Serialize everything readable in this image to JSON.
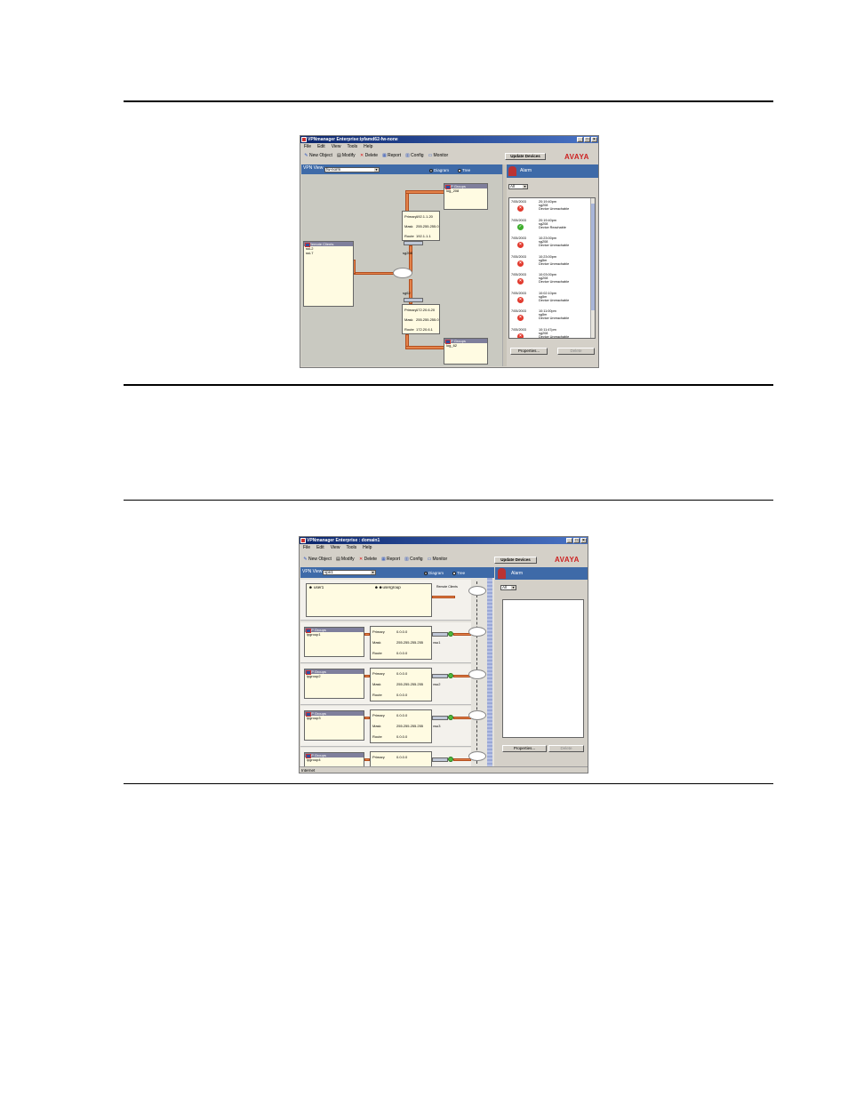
{
  "menu": [
    "File",
    "Edit",
    "View",
    "Tools",
    "Help"
  ],
  "toolbar": {
    "new_object": "New Object",
    "modify": "Modify",
    "delete": "Delete",
    "report": "Report",
    "config": "Config",
    "monitor": "Monitor"
  },
  "update_devices": "Update Devices",
  "brand": "AVAYA",
  "vpn_view_label": "VPN View",
  "view_diagram": "Diagram",
  "view_tree": "Tree",
  "alarm_label": "Alarm",
  "alarm_filter": "All",
  "properties_button": "Properties...",
  "delete_button": "Delete",
  "window1": {
    "title": "VPNmanager Enterprise:ipfamd62-fw-none",
    "vpn_view_value": "fw-norm",
    "ipgroups": [
      {
        "header": "IP Groups",
        "name": "log_208"
      },
      {
        "header": "IP Groups",
        "name": "log_62"
      }
    ],
    "remote_clients": {
      "header": "Remote Clients",
      "items": [
        "ssi-2",
        "ssi-7"
      ]
    },
    "info_top": {
      "primary_label": "Primary",
      "primary": "192.1.1.20",
      "mask_label": "Mask",
      "mask": "255.255.255.0",
      "route_label": "Route",
      "route": "192.1.1.1"
    },
    "info_bottom": {
      "primary_label": "Primary",
      "primary": "172.20.6.20",
      "mask_label": "Mask",
      "mask": "255.255.255.0",
      "route_label": "Route",
      "route": "172.20.6.1"
    },
    "device_top": "sg208",
    "device_bottom": "sg62",
    "alarms": [
      {
        "date": "7/05/2003",
        "time": "20:19:40pm",
        "device": "sg208",
        "status": "Device Unreachable",
        "ok": false
      },
      {
        "date": "7/05/2003",
        "time": "20:19:40pm",
        "device": "sg208",
        "status": "Device Reachable",
        "ok": true
      },
      {
        "date": "7/05/2003",
        "time": "10:23:00pm",
        "device": "sg208",
        "status": "Device Unreachable",
        "ok": false
      },
      {
        "date": "7/05/2003",
        "time": "10:23:00pm",
        "device": "sg5m",
        "status": "Device Unreachable",
        "ok": false
      },
      {
        "date": "7/05/2003",
        "time": "10:03:00pm",
        "device": "sg208",
        "status": "Device Unreachable",
        "ok": false
      },
      {
        "date": "7/05/2003",
        "time": "10:02:10pm",
        "device": "sg5m",
        "status": "Device Unreachable",
        "ok": false
      },
      {
        "date": "7/05/2003",
        "time": "10:11:00pm",
        "device": "sg5m",
        "status": "Device Unreachable",
        "ok": false
      },
      {
        "date": "7/05/2003",
        "time": "10:11:47pm",
        "device": "sg208",
        "status": "Device Unreachable",
        "ok": false
      }
    ]
  },
  "window2": {
    "title": "VPNmanager Enterprise : domain1",
    "vpn_view_value": "vpn1",
    "user": {
      "name": "user1",
      "group": "usergroup",
      "remote_clients": "Remote Clients"
    },
    "rows": [
      {
        "header": "IP Groups",
        "name": "ipgroup1",
        "primary_label": "Primary",
        "primary": "0.0.0.0",
        "mask_label": "Mask",
        "mask": "255.255.255.255",
        "route_label": "Route",
        "route": "0.0.0.0",
        "device": "vsu1"
      },
      {
        "header": "IP Groups",
        "name": "ipgroup2",
        "primary_label": "Primary",
        "primary": "0.0.0.0",
        "mask_label": "Mask",
        "mask": "255.255.255.255",
        "route_label": "Route",
        "route": "0.0.0.0",
        "device": "vsu2"
      },
      {
        "header": "IP Groups",
        "name": "ipgroup3",
        "primary_label": "Primary",
        "primary": "0.0.0.0",
        "mask_label": "Mask",
        "mask": "255.255.255.255",
        "route_label": "Route",
        "route": "0.0.0.0",
        "device": "vsu3"
      },
      {
        "header": "IP Groups",
        "name": "ipgroup4",
        "primary_label": "Primary",
        "primary": "0.0.0.0"
      }
    ],
    "status": "Internet"
  }
}
